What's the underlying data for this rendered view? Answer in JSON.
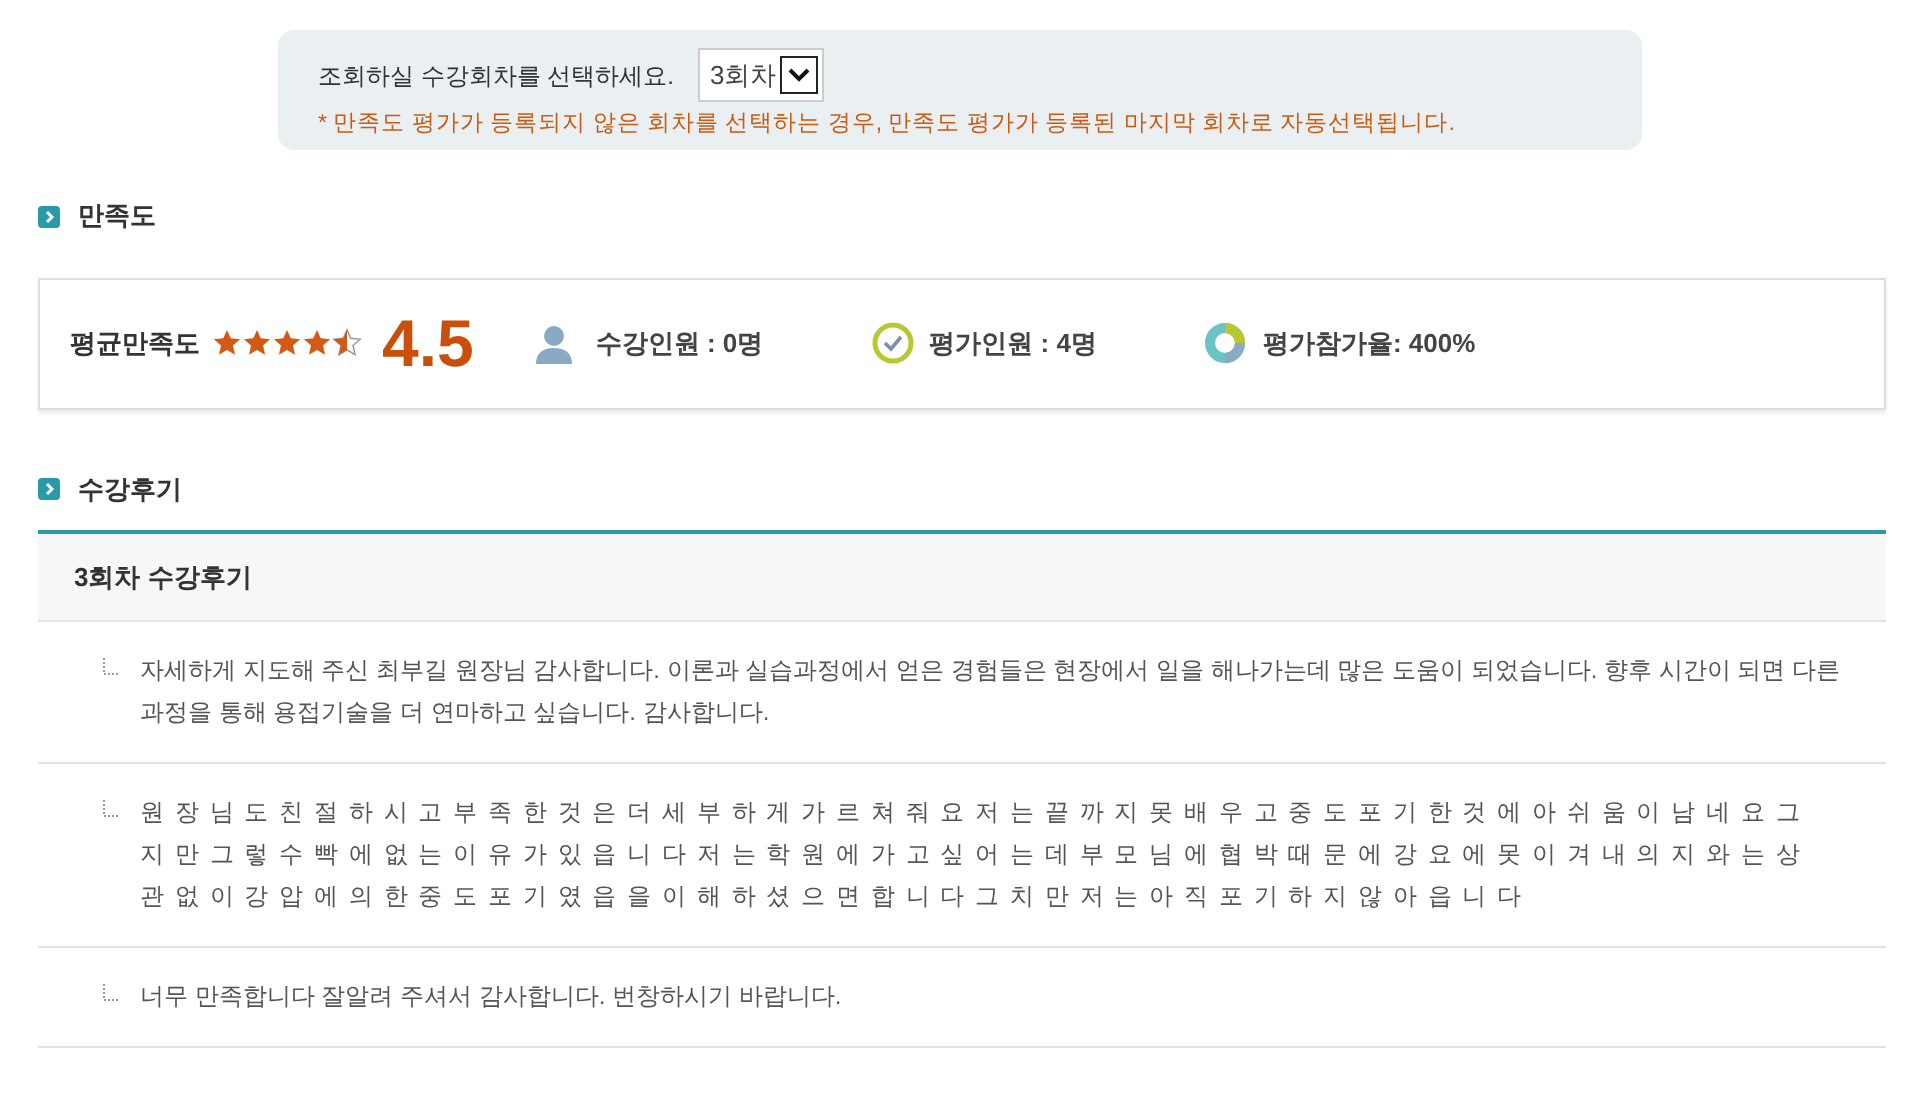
{
  "session_selector": {
    "label": "조회하실 수강회차를 선택하세요.",
    "value": "3회차",
    "note": "* 만족도 평가가 등록되지 않은 회차를 선택하는 경우, 만족도 평가가 등록된 마지막 회차로 자동선택됩니다."
  },
  "satisfaction": {
    "heading": "만족도",
    "average_label": "평균만족도",
    "stars": 4.5,
    "score": "4.5",
    "enrolled": "수강인원 : 0명",
    "evaluators": "평가인원 : 4명",
    "participation": "평가참가율: 400%"
  },
  "reviews": {
    "heading": "수강후기",
    "title": "3회차 수강후기",
    "items": [
      {
        "text": "자세하게 지도해 주신 최부길 원장님 감사합니다. 이론과 실습과정에서 얻은 경험들은 현장에서 일을 해나가는데 많은 도움이 되었습니다. 향후 시간이 되면 다른 과정을 통해 용접기술을 더 연마하고 싶습니다. 감사합니다.",
        "spaced": false
      },
      {
        "text": "원장님도친절하시고부족한것은더세부하게가르쳐줘요저는끝까지못배우고중도포기한것에아쉬움이남네요그지만그렇수빡에없는이유가있읍니다저는학원에가고싶어는데부모님에협박때문에강요에못이겨내의지와는상관없이강압에의한중도포기였읍을이해하셨으면합니다그치만저는아직포기하지않아읍니다",
        "spaced": true
      },
      {
        "text": "너무 만족합니다 잘알려 주셔서 감사합니다. 번창하시기 바랍니다.",
        "spaced": false
      }
    ]
  }
}
